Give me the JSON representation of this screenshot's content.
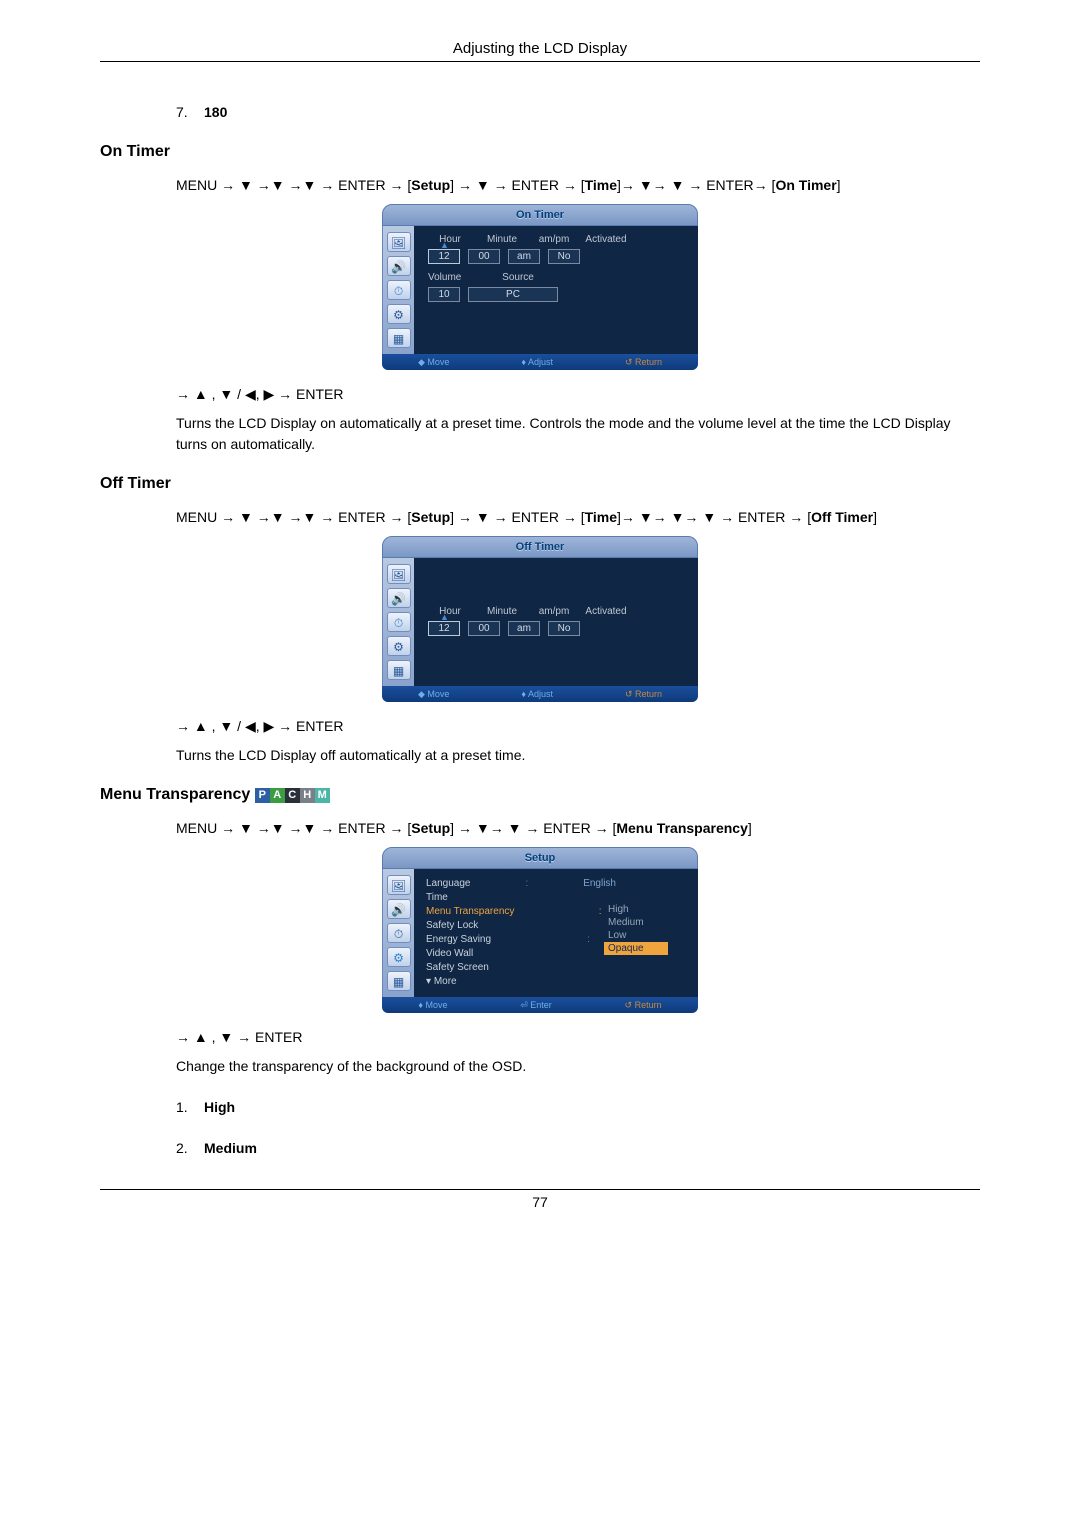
{
  "header": "Adjusting the LCD Display",
  "page_number": "77",
  "item7": {
    "num": "7.",
    "value": "180"
  },
  "on_timer": {
    "title": "On Timer",
    "nav_prefix": "MENU ",
    "setup_label": "Setup",
    "time_label": "Time",
    "post_nav": "On Timer",
    "osd_title": "On Timer",
    "labels": {
      "hour": "Hour",
      "minute": "Minute",
      "ampm": "am/pm",
      "activated": "Activated",
      "volume": "Volume",
      "source": "Source"
    },
    "vals": {
      "hour": "12",
      "minute": "00",
      "ampm": "am",
      "activated": "No",
      "volume": "10",
      "source": "PC"
    },
    "footer": {
      "move": "Move",
      "adjust": "Adjust",
      "ret": "Return"
    },
    "adj_seq": "→ ▲ , ▼ / ◀, ▶ → ENTER",
    "desc": "Turns the LCD Display on automatically at a preset time. Controls the mode and the volume level at the time the LCD Display turns on automatically."
  },
  "off_timer": {
    "title": "Off Timer",
    "post_nav": "Off Timer",
    "osd_title": "Off Timer",
    "labels": {
      "hour": "Hour",
      "minute": "Minute",
      "ampm": "am/pm",
      "activated": "Activated"
    },
    "vals": {
      "hour": "12",
      "minute": "00",
      "ampm": "am",
      "activated": "No"
    },
    "footer": {
      "move": "Move",
      "adjust": "Adjust",
      "ret": "Return"
    },
    "adj_seq": "→ ▲ , ▼ / ◀, ▶ → ENTER",
    "desc": "Turns the LCD Display off automatically at a preset time."
  },
  "menu_trans": {
    "title": "Menu Transparency",
    "badges": [
      "P",
      "A",
      "C",
      "H",
      "M"
    ],
    "post_nav": "Menu Transparency",
    "osd_title": "Setup",
    "items": [
      "Language",
      "Time",
      "Menu Transparency",
      "Safety Lock",
      "Energy Saving",
      "Video Wall",
      "Safety Screen"
    ],
    "more": "More",
    "lang_val": "English",
    "options": [
      "High",
      "Medium",
      "Low",
      "Opaque"
    ],
    "selected_option": "Opaque",
    "footer": {
      "move": "Move",
      "enter": "Enter",
      "ret": "Return"
    },
    "adj_seq": "→ ▲ , ▼ → ENTER",
    "desc": "Change the transparency of the background of the OSD.",
    "list1": {
      "num": "1.",
      "value": "High"
    },
    "list2": {
      "num": "2.",
      "value": "Medium"
    }
  },
  "common": {
    "enter": "ENTER",
    "menu": "MENU"
  }
}
